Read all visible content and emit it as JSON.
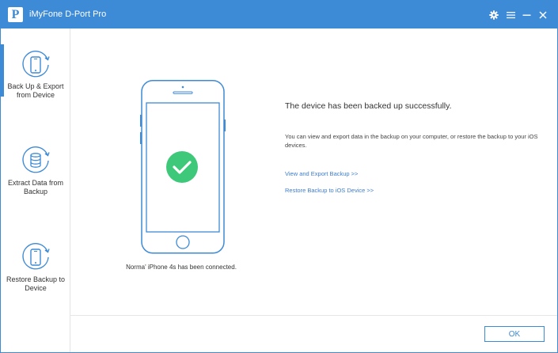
{
  "window": {
    "logo_letter": "P",
    "title": "iMyFone D-Port Pro"
  },
  "titlebar_buttons": [
    {
      "name": "settings",
      "icon": "gear-icon"
    },
    {
      "name": "menu",
      "icon": "menu-icon"
    },
    {
      "name": "minimize",
      "icon": "minimize-icon"
    },
    {
      "name": "close",
      "icon": "close-icon"
    }
  ],
  "sidebar": {
    "items": [
      {
        "label": "Back Up & Export from Device",
        "icon": "phone-backup-icon",
        "active": true
      },
      {
        "label": "Extract Data  from Backup",
        "icon": "database-icon",
        "active": false
      },
      {
        "label": "Restore Backup to Device",
        "icon": "phone-restore-icon",
        "active": false
      }
    ]
  },
  "device": {
    "connected_message": "Norma' iPhone 4s has been connected.",
    "status_icon": "check-circle-icon"
  },
  "result": {
    "title": "The device has been backed up successfully.",
    "description": "You can view and export data in the backup on your computer, or restore the backup to your iOS devices.",
    "links": {
      "view_export": "View and Export Backup >>",
      "restore": "Restore Backup to iOS Device >>"
    }
  },
  "footer": {
    "ok_label": "OK"
  },
  "colors": {
    "accent": "#3d8ad6",
    "success": "#3ec97a",
    "link": "#3d7dd0"
  }
}
